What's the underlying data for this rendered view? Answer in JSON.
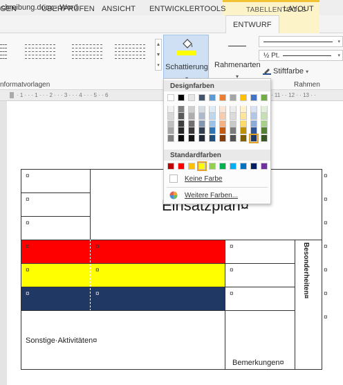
{
  "window": {
    "title_fragment": "chreibung.docx - Word"
  },
  "contextual_tab": {
    "label": "TABELLENTOOLS"
  },
  "ribbon_tabs": [
    {
      "label": "GEN",
      "active": false
    },
    {
      "label": "ÜBERPRÜFEN",
      "active": false
    },
    {
      "label": "ANSICHT",
      "active": false
    },
    {
      "label": "ENTWICKLERTOOLS",
      "active": false
    },
    {
      "label": "ENTWURF",
      "active": true
    },
    {
      "label": "LAYOUT",
      "active": false
    }
  ],
  "ribbon": {
    "shading_label": "Schattierung",
    "border_styles_label": "Rahmenarten",
    "weight_value": "½ Pt.",
    "pen_color_label": "Stiftfarbe",
    "group_table_styles": "nformatvorlagen",
    "group_borders": "Rahmen",
    "shading_color": "#ffff00"
  },
  "ruler": {
    "left_text": "· 1 · · · 1 · · · 2 · · · 3 · · · 4 · · · 5 · · 6",
    "right_text": "· 11 · · 12 · · 13 · ·"
  },
  "dropdown": {
    "theme_colors_header": "Designfarben",
    "standard_colors_header": "Standardfarben",
    "no_color_label": "Keine Farbe",
    "more_colors_label": "Weitere Farben...",
    "theme_colors": [
      [
        "#ffffff",
        "#000000",
        "#e7e6e6",
        "#44546a",
        "#5b9bd5",
        "#ed7d31",
        "#a5a5a5",
        "#ffc000",
        "#4472c4",
        "#70ad47"
      ],
      [
        "#f2f2f2",
        "#7f7f7f",
        "#d0cece",
        "#d6dce4",
        "#deebf6",
        "#fbe5d5",
        "#ededed",
        "#fff2cc",
        "#dae3f3",
        "#e2efd9"
      ],
      [
        "#d8d8d8",
        "#595959",
        "#aeabab",
        "#adb9ca",
        "#bdd7ee",
        "#f7cbac",
        "#dbdbdb",
        "#fee599",
        "#b4c6e7",
        "#c5e0b3"
      ],
      [
        "#bfbfbf",
        "#3f3f3f",
        "#757070",
        "#8496b0",
        "#9cc3e5",
        "#f4b183",
        "#c9c9c9",
        "#ffd965",
        "#8eaadb",
        "#a8d08d"
      ],
      [
        "#a5a5a5",
        "#262626",
        "#3a3838",
        "#323f4f",
        "#2e75b5",
        "#c55a11",
        "#7b7b7b",
        "#bf9000",
        "#2f5496",
        "#538135"
      ],
      [
        "#7f7f7f",
        "#0c0c0c",
        "#171616",
        "#222a35",
        "#1e4e79",
        "#843c0b",
        "#525252",
        "#7f6000",
        "#1f3864",
        "#375623"
      ]
    ],
    "standard_colors": [
      "#c00000",
      "#ff0000",
      "#ffc000",
      "#ffff00",
      "#92d050",
      "#00b050",
      "#00b0f0",
      "#0070c0",
      "#002060",
      "#7030a0"
    ],
    "selected_theme": [
      5,
      8
    ],
    "selected_standard": 3
  },
  "document": {
    "pilcrow": "¤",
    "title": "Einsatzplan¤",
    "side_heading": "Besonderheiten¤",
    "other_activities": "Sonstige·Aktivitäten¤",
    "remarks": "Bemerkungen¤",
    "row_colors": [
      "#ff0000",
      "#ffff00",
      "#1f3864"
    ]
  }
}
